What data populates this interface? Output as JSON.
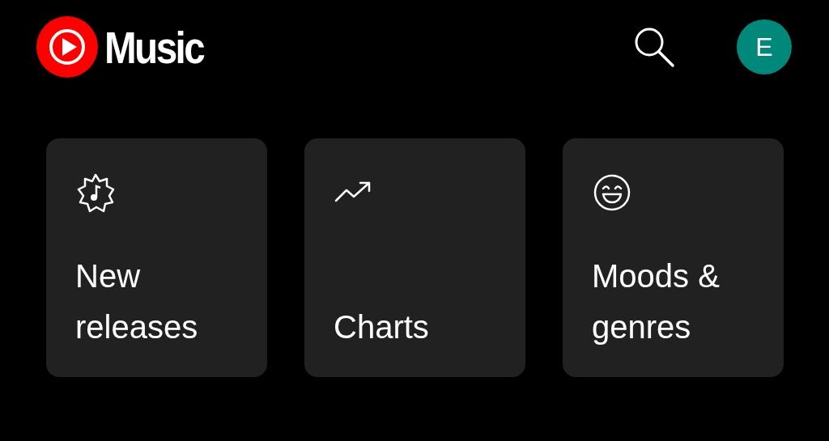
{
  "header": {
    "logo_text": "Music",
    "avatar_initial": "E"
  },
  "cards": [
    {
      "kind": "new-releases",
      "label": "New releases"
    },
    {
      "kind": "charts",
      "label": "Charts"
    },
    {
      "kind": "moods",
      "label": "Moods & genres"
    }
  ]
}
